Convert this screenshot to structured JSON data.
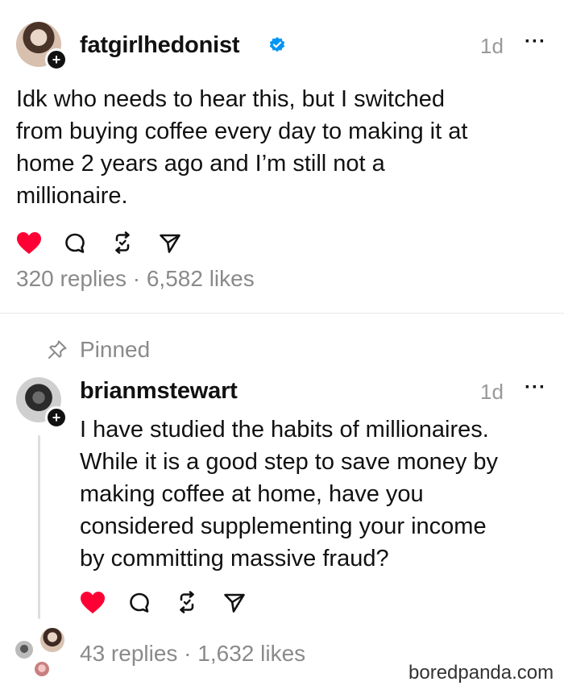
{
  "post": {
    "username": "fatgirlhedonist",
    "time": "1d",
    "more": "···",
    "text_lines": [
      "Idk who needs to hear this, but I switched",
      "from buying coffee every day to making it at",
      "home 2 years ago and I’m still not a",
      "millionaire."
    ],
    "counts": "320 replies · 6,582 likes",
    "follow_badge": "+"
  },
  "pinned_label": "Pinned",
  "reply": {
    "username": "brianmstewart",
    "time": "1d",
    "more": "···",
    "text_lines": [
      "I have studied the habits of millionaires.",
      "While it is a good step to save money by",
      "making coffee at home, have you",
      "considered supplementing your income",
      "by committing massive fraud?"
    ],
    "counts": "43 replies · 1,632 likes",
    "follow_badge": "+"
  },
  "watermark": "boredpanda.com",
  "colors": {
    "like_red": "#ff0034",
    "verified_blue": "#0095f6",
    "muted_gray": "#8a8a8a"
  },
  "icons": [
    "heart-icon",
    "comment-icon",
    "repost-icon",
    "share-icon",
    "pin-icon",
    "verified-badge-icon"
  ]
}
